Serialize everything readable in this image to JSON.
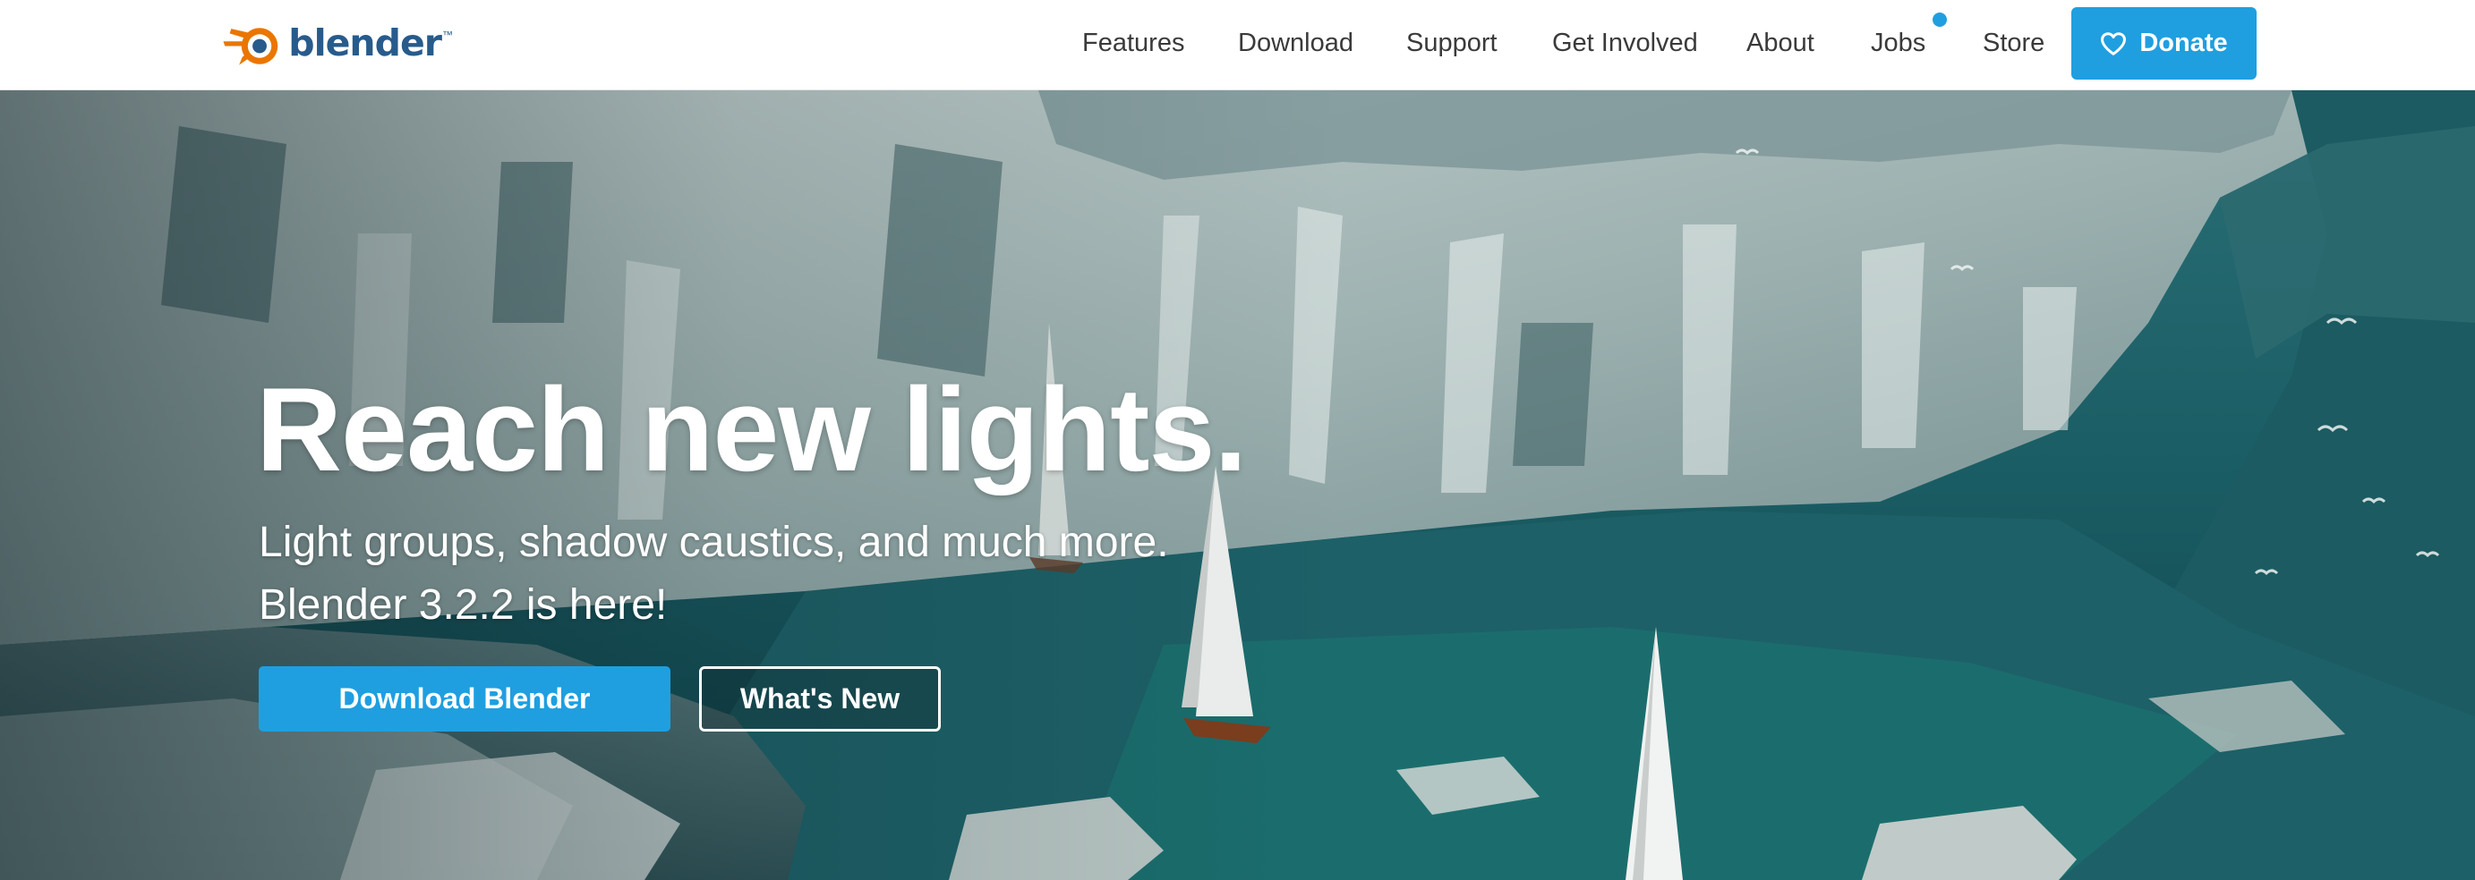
{
  "brand": {
    "name": "blender",
    "trademark": "™",
    "logo_color": "#275b8c",
    "logo_accent": "#ea7600"
  },
  "nav": {
    "items": [
      {
        "label": "Features"
      },
      {
        "label": "Download"
      },
      {
        "label": "Support"
      },
      {
        "label": "Get Involved"
      },
      {
        "label": "About"
      },
      {
        "label": "Jobs",
        "has_notification_dot": true
      },
      {
        "label": "Store"
      }
    ],
    "donate_label": "Donate",
    "donate_icon": "heart-icon",
    "accent_color": "#1f9fe0"
  },
  "hero": {
    "title": "Reach new lights.",
    "subtitle": "Light groups, shadow caustics, and much more.",
    "version_text": "Blender 3.2.2 is here!",
    "primary_button": "Download Blender",
    "secondary_button": "What's New",
    "background": "icebergs-and-sailboats-scene"
  }
}
